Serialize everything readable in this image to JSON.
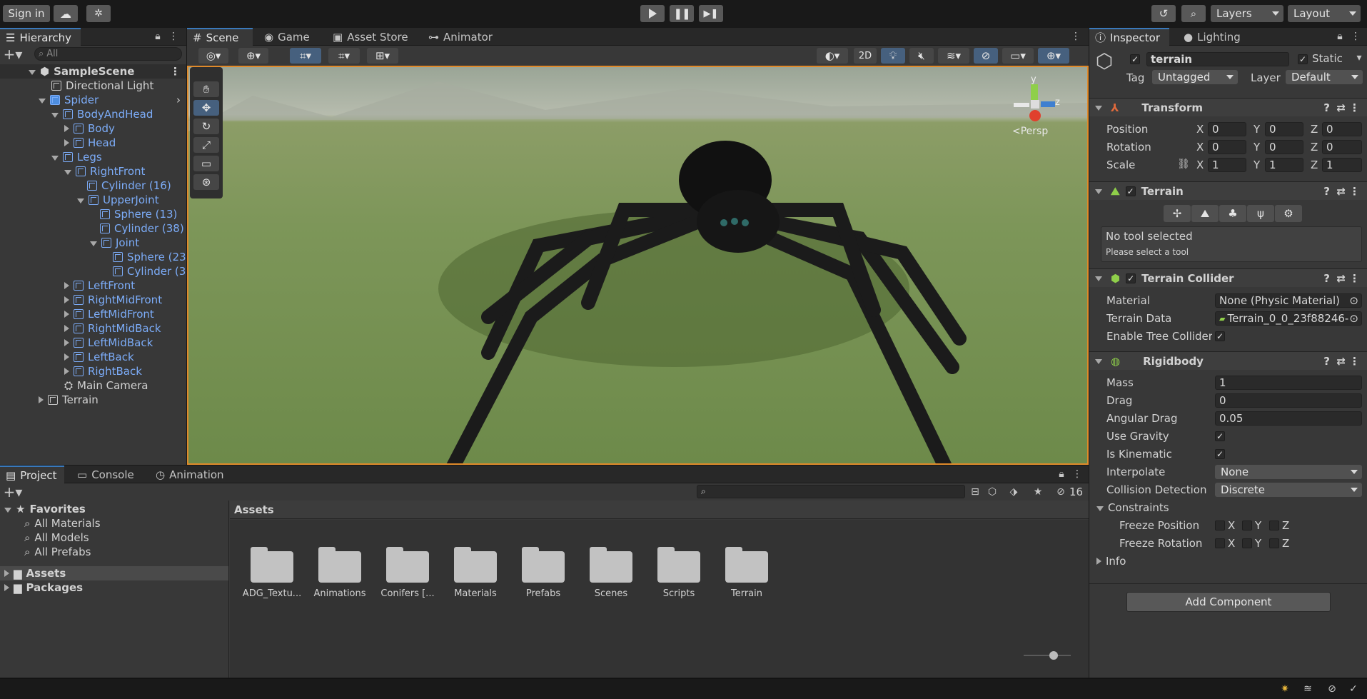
{
  "toolbar": {
    "sign_in": "Sign in",
    "layers": "Layers",
    "layout": "Layout"
  },
  "hierarchy": {
    "tab": "Hierarchy",
    "search_placeholder": "All",
    "items": [
      {
        "label": "SampleScene"
      },
      {
        "label": "Directional Light"
      },
      {
        "label": "Spider"
      },
      {
        "label": "BodyAndHead"
      },
      {
        "label": "Body"
      },
      {
        "label": "Head"
      },
      {
        "label": "Legs"
      },
      {
        "label": "RightFront"
      },
      {
        "label": "Cylinder (16)"
      },
      {
        "label": "UpperJoint"
      },
      {
        "label": "Sphere (13)"
      },
      {
        "label": "Cylinder (38)"
      },
      {
        "label": "Joint"
      },
      {
        "label": "Sphere (23"
      },
      {
        "label": "Cylinder (3"
      },
      {
        "label": "LeftFront"
      },
      {
        "label": "RightMidFront"
      },
      {
        "label": "LeftMidFront"
      },
      {
        "label": "RightMidBack"
      },
      {
        "label": "LeftMidBack"
      },
      {
        "label": "LeftBack"
      },
      {
        "label": "RightBack"
      },
      {
        "label": "Main Camera"
      },
      {
        "label": "Terrain"
      }
    ]
  },
  "scene_tabs": [
    {
      "label": "Scene"
    },
    {
      "label": "Game"
    },
    {
      "label": "Asset Store"
    },
    {
      "label": "Animator"
    }
  ],
  "scene": {
    "btn_2d": "2D",
    "persp": "<Persp",
    "gizmo_y": "y",
    "gizmo_z": "z"
  },
  "inspector": {
    "tab": "Inspector",
    "tab2": "Lighting",
    "object_name": "terrain",
    "static": "Static",
    "tag_label": "Tag",
    "tag_value": "Untagged",
    "layer_label": "Layer",
    "layer_value": "Default",
    "transform": {
      "title": "Transform",
      "position": "Position",
      "rotation": "Rotation",
      "scale": "Scale",
      "x": "X",
      "y": "Y",
      "z": "Z",
      "pos": [
        "0",
        "0",
        "0"
      ],
      "rot": [
        "0",
        "0",
        "0"
      ],
      "scl": [
        "1",
        "1",
        "1"
      ]
    },
    "terrain": {
      "title": "Terrain",
      "no_tool": "No tool selected",
      "please": "Please select a tool"
    },
    "collider": {
      "title": "Terrain Collider",
      "material_label": "Material",
      "material_value": "None (Physic Material)",
      "data_label": "Terrain Data",
      "data_value": "Terrain_0_0_23f88246-",
      "tree_label": "Enable Tree Colliders"
    },
    "rigidbody": {
      "title": "Rigidbody",
      "mass_label": "Mass",
      "mass": "1",
      "drag_label": "Drag",
      "drag": "0",
      "adrag_label": "Angular Drag",
      "adrag": "0.05",
      "gravity_label": "Use Gravity",
      "kinematic_label": "Is Kinematic",
      "interp_label": "Interpolate",
      "interp": "None",
      "coll_label": "Collision Detection",
      "coll": "Discrete",
      "constraints": "Constraints",
      "freeze_pos": "Freeze Position",
      "freeze_rot": "Freeze Rotation",
      "info": "Info"
    },
    "add_component": "Add Component"
  },
  "project": {
    "tabs": [
      {
        "label": "Project"
      },
      {
        "label": "Console"
      },
      {
        "label": "Animation"
      }
    ],
    "favorites": "Favorites",
    "fav_items": [
      {
        "label": "All Materials"
      },
      {
        "label": "All Models"
      },
      {
        "label": "All Prefabs"
      }
    ],
    "assets": "Assets",
    "packages": "Packages",
    "breadcrumb": "Assets",
    "hidden_count": "16",
    "folders": [
      {
        "label": "ADG_Textu..."
      },
      {
        "label": "Animations"
      },
      {
        "label": "Conifers [..."
      },
      {
        "label": "Materials"
      },
      {
        "label": "Prefabs"
      },
      {
        "label": "Scenes"
      },
      {
        "label": "Scripts"
      },
      {
        "label": "Terrain"
      }
    ]
  }
}
